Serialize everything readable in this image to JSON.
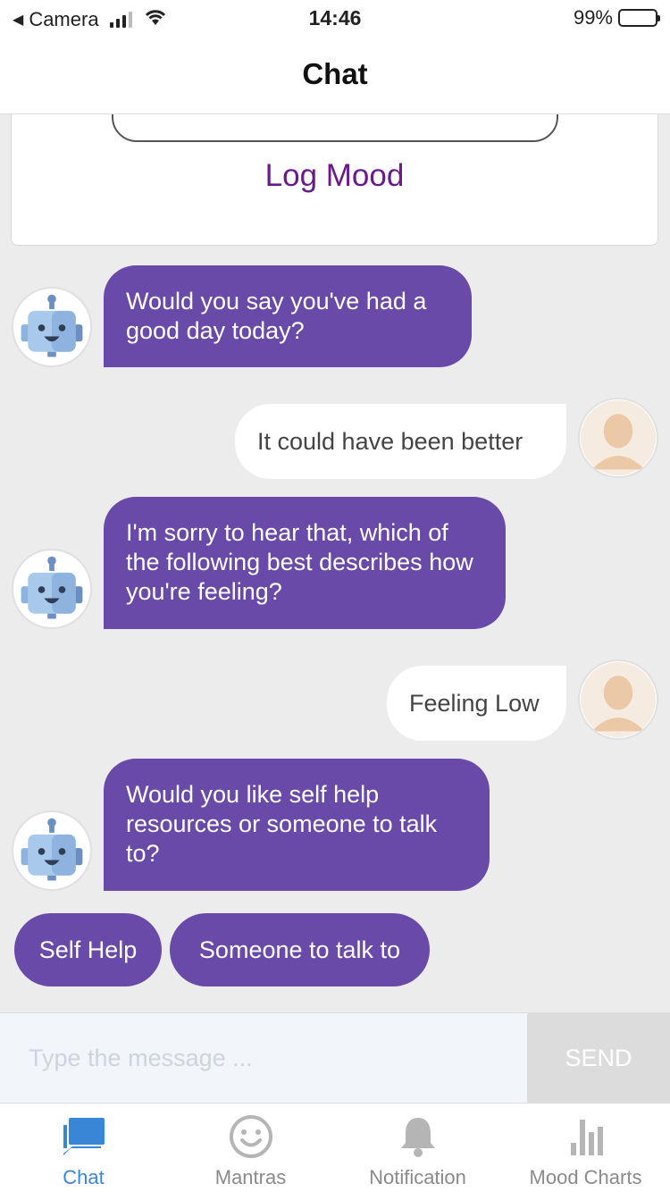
{
  "status_bar": {
    "back_app": "Camera",
    "time": "14:46",
    "battery": "99%"
  },
  "nav": {
    "title": "Chat"
  },
  "mood_card": {
    "action_label": "Log Mood"
  },
  "messages": [
    {
      "sender": "bot",
      "text": "Would you say you've had a good day today?"
    },
    {
      "sender": "user",
      "text": "It could have been better"
    },
    {
      "sender": "bot",
      "text": "I'm sorry to hear that, which of the following best describes how you're feeling?"
    },
    {
      "sender": "user",
      "text": "Feeling Low"
    },
    {
      "sender": "bot",
      "text": "Would you like self help resources or someone to talk to?"
    }
  ],
  "quick_replies": [
    "Self Help",
    "Someone to talk to"
  ],
  "composer": {
    "placeholder": "Type the message ...",
    "send_label": "SEND"
  },
  "tabs": [
    {
      "label": "Chat",
      "icon": "chat-bubble-icon",
      "active": true
    },
    {
      "label": "Mantras",
      "icon": "smiley-icon",
      "active": false
    },
    {
      "label": "Notification",
      "icon": "bell-icon",
      "active": false
    },
    {
      "label": "Mood Charts",
      "icon": "bar-chart-icon",
      "active": false
    }
  ],
  "colors": {
    "bot_bubble": "#6a4aa8",
    "accent_purple": "#6a1b8a",
    "active_tab": "#3a86d6"
  }
}
